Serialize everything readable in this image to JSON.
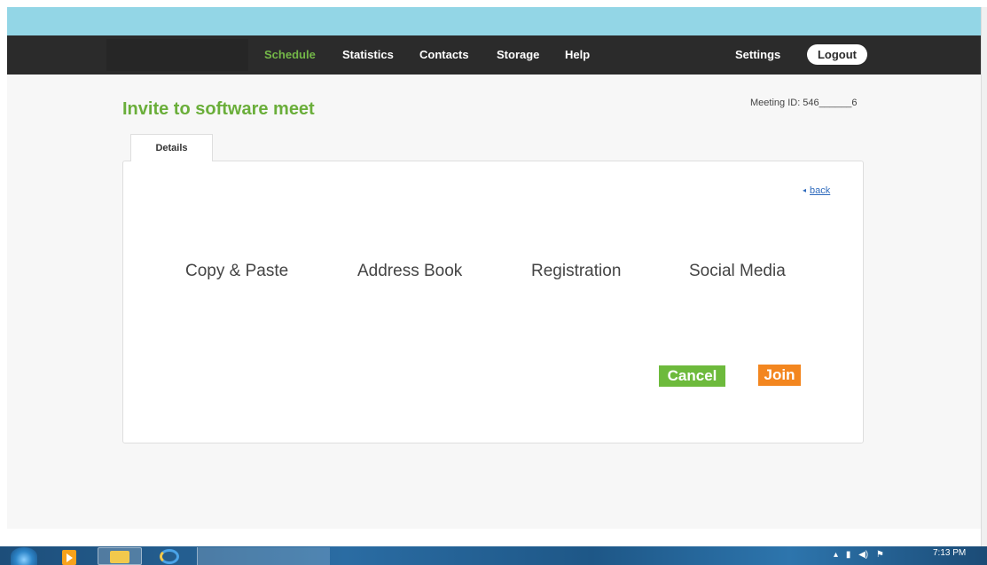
{
  "nav": {
    "items": [
      {
        "label": "Schedule",
        "active": true
      },
      {
        "label": "Statistics",
        "active": false
      },
      {
        "label": "Contacts",
        "active": false
      },
      {
        "label": "Storage",
        "active": false
      },
      {
        "label": "Help",
        "active": false
      }
    ],
    "settings_label": "Settings",
    "logout_label": "Logout"
  },
  "page": {
    "title": "Invite to software meet",
    "meeting_id": "Meeting ID: 546______6"
  },
  "tabs": [
    {
      "label": "Details",
      "active": true
    }
  ],
  "panel": {
    "back_label": "back",
    "options": [
      {
        "label": "Copy & Paste"
      },
      {
        "label": "Address Book"
      },
      {
        "label": "Registration"
      },
      {
        "label": "Social Media"
      }
    ],
    "cancel_label": "Cancel",
    "join_label": "Join"
  },
  "taskbar": {
    "clock": "7:13 PM",
    "icons": [
      "windows-start-icon",
      "media-player-icon",
      "folder-icon",
      "browser-icon"
    ]
  },
  "colors": {
    "accent_green": "#6aae3a",
    "cancel_green": "#6dba3c",
    "join_orange": "#f3861f",
    "navbar": "#2b2b2b",
    "banner": "#93d6e6",
    "link_blue": "#2f6bbd"
  }
}
